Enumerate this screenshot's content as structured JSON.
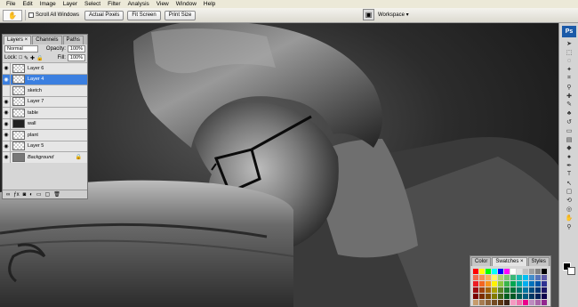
{
  "menu": [
    "File",
    "Edit",
    "Image",
    "Layer",
    "Select",
    "Filter",
    "Analysis",
    "View",
    "Window",
    "Help"
  ],
  "options_bar": {
    "scroll_all_windows": "Scroll All Windows",
    "actual_pixels": "Actual Pixels",
    "fit_screen": "Fit Screen",
    "print_size": "Print Size",
    "workspace": "Workspace ▾"
  },
  "layers_panel": {
    "tabs": [
      "Layers ×",
      "Channels",
      "Paths"
    ],
    "blend_mode": "Normal",
    "opacity_label": "Opacity:",
    "opacity_value": "100%",
    "lock_label": "Lock:",
    "fill_label": "Fill:",
    "fill_value": "100%",
    "layers": [
      {
        "name": "Layer 6",
        "visible": true,
        "thumb": "transparent"
      },
      {
        "name": "Layer 4",
        "visible": true,
        "thumb": "transparent",
        "selected": true
      },
      {
        "name": "sketch",
        "visible": false,
        "thumb": "transparent"
      },
      {
        "name": "Layer 7",
        "visible": true,
        "thumb": "transparent"
      },
      {
        "name": "table",
        "visible": true,
        "thumb": "transparent"
      },
      {
        "name": "wall",
        "visible": true,
        "thumb": "dark"
      },
      {
        "name": "plant",
        "visible": true,
        "thumb": "transparent"
      },
      {
        "name": "Layer 5",
        "visible": true,
        "thumb": "transparent"
      },
      {
        "name": "Background",
        "visible": true,
        "thumb": "gray",
        "locked": true
      }
    ]
  },
  "toolbox": {
    "logo": "Ps"
  },
  "swatches_panel": {
    "tabs": [
      "Color",
      "Swatches ×",
      "Styles"
    ],
    "colors": [
      "#ff0000",
      "#ffff00",
      "#00ff00",
      "#00ffff",
      "#0000ff",
      "#ff00ff",
      "#ffffff",
      "#e0e0e0",
      "#c0c0c0",
      "#a0a0a0",
      "#808080",
      "#000000",
      "#f26c4f",
      "#f68e55",
      "#fbaf5c",
      "#fff467",
      "#acd372",
      "#7cc576",
      "#3bb878",
      "#1abbb4",
      "#00bff3",
      "#438cca",
      "#5574b9",
      "#605ca8",
      "#ed1c24",
      "#f26522",
      "#f7941d",
      "#fff200",
      "#8dc63f",
      "#39b54a",
      "#00a651",
      "#00a99d",
      "#00aeef",
      "#0072bc",
      "#0054a6",
      "#2e3192",
      "#9e0b0f",
      "#a0410d",
      "#a36209",
      "#aba000",
      "#598527",
      "#1a7b30",
      "#007236",
      "#00746b",
      "#0076a3",
      "#004b80",
      "#003471",
      "#1b1464",
      "#790000",
      "#7b2e00",
      "#7d4900",
      "#827b00",
      "#406618",
      "#005e20",
      "#005826",
      "#005952",
      "#005b7f",
      "#003663",
      "#002157",
      "#0d004c",
      "#c69c6d",
      "#a67c52",
      "#8c6239",
      "#754c24",
      "#603913",
      "#3c2415",
      "#f49ac1",
      "#f06eaa",
      "#ec008c",
      "#bd8cbf",
      "#a864a8",
      "#92278f"
    ]
  }
}
